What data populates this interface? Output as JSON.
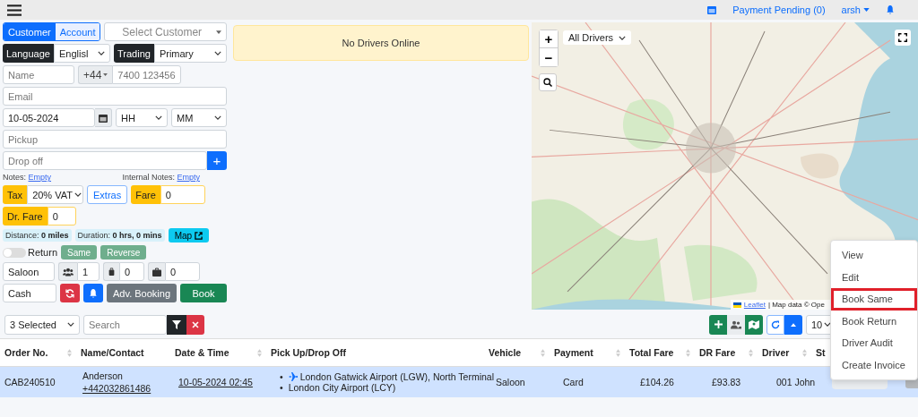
{
  "topbar": {
    "payment_pending": "Payment Pending (0)",
    "user": "arsh"
  },
  "form": {
    "customer_type": [
      {
        "label": "Customer",
        "selected": true
      },
      {
        "label": "Account",
        "selected": false
      }
    ],
    "customer_select": {
      "placeholder": "Select Customer"
    },
    "language": {
      "label": "Language",
      "value": "Englisl"
    },
    "trading": {
      "label": "Trading",
      "value": "Primary"
    },
    "name": {
      "placeholder": "Name"
    },
    "phone": {
      "code": "+44",
      "placeholder": "7400 123456"
    },
    "email": {
      "placeholder": "Email"
    },
    "date": {
      "value": "10-05-2024"
    },
    "hour": {
      "value": "HH"
    },
    "minute": {
      "value": "MM"
    },
    "pickup": {
      "placeholder": "Pickup"
    },
    "dropoff": {
      "placeholder": "Drop off"
    },
    "add_stop_button": "+",
    "notes": {
      "label": "Notes:",
      "value": "Empty"
    },
    "internal_notes": {
      "label": "Internal Notes:",
      "value": "Empty"
    },
    "tax": {
      "label": "Tax",
      "value": "20% VAT"
    },
    "extras_button": "Extras",
    "fare": {
      "label": "Fare",
      "value": "0"
    },
    "dr_fare": {
      "label": "Dr. Fare",
      "value": "0"
    },
    "distance": {
      "label": "Distance:",
      "value": "0 miles"
    },
    "duration": {
      "label": "Duration:",
      "value": "0 hrs, 0 mins"
    },
    "map_button": "Map",
    "return": {
      "label": "Return",
      "on": false
    },
    "same_button": "Same",
    "reverse_button": "Reverse",
    "vehicle": "Saloon",
    "passengers": "1",
    "hand_luggage": "0",
    "suitcases": "0",
    "payment": "Cash",
    "adv_booking_button": "Adv. Booking",
    "book_button": "Book"
  },
  "drivers_alert": "No Drivers Online",
  "map": {
    "zoom_in": "+",
    "zoom_out": "−",
    "driver_filter": "All Drivers",
    "attribution_link": "Leaflet",
    "attribution": "| Map data © Ope"
  },
  "table_toolbar": {
    "columns_select": "3 Selected",
    "search": {
      "placeholder": "Search"
    },
    "page_size": "10"
  },
  "table": {
    "columns": [
      {
        "label": "Order No.",
        "sortable": true
      },
      {
        "label": "Name/Contact",
        "sortable": false
      },
      {
        "label": "Date & Time",
        "sortable": true
      },
      {
        "label": "Pick Up/Drop Off",
        "sortable": false
      },
      {
        "label": "Vehicle",
        "sortable": true
      },
      {
        "label": "Payment",
        "sortable": true
      },
      {
        "label": "Total Fare",
        "sortable": true
      },
      {
        "label": "DR Fare",
        "sortable": true
      },
      {
        "label": "Driver",
        "sortable": true
      },
      {
        "label": "St"
      }
    ],
    "rows": [
      {
        "selected": true,
        "bullet": "•",
        "order_no": "CAB240510",
        "name": "Anderson",
        "contact": "+442032861486",
        "date_time": "10-05-2024 02:45",
        "pickup": "London Gatwick Airport (LGW), North Terminal",
        "dropoff": "London City Airport (LCY)",
        "vehicle": "Saloon",
        "payment": "Card",
        "total_fare": "£104.26",
        "dr_fare": "£93.83",
        "driver": "001 John"
      }
    ]
  },
  "context_menu": [
    {
      "label": "View",
      "highlighted": false
    },
    {
      "label": "Edit",
      "highlighted": false
    },
    {
      "label": "Book Same",
      "highlighted": true
    },
    {
      "label": "Book Return",
      "highlighted": false
    },
    {
      "label": "Driver Audit",
      "highlighted": false
    },
    {
      "label": "Create Invoice",
      "highlighted": false
    }
  ]
}
